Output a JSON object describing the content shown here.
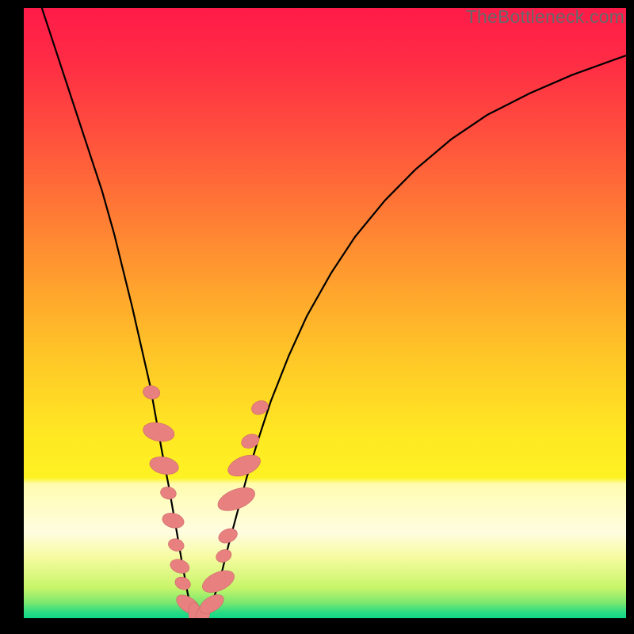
{
  "watermark": "TheBottleneck.com",
  "colors": {
    "gradient_stops": [
      {
        "offset": 0.0,
        "color": "#ff1b49"
      },
      {
        "offset": 0.08,
        "color": "#ff2a45"
      },
      {
        "offset": 0.2,
        "color": "#ff4d3e"
      },
      {
        "offset": 0.32,
        "color": "#ff7536"
      },
      {
        "offset": 0.45,
        "color": "#ffa02e"
      },
      {
        "offset": 0.58,
        "color": "#ffc927"
      },
      {
        "offset": 0.7,
        "color": "#ffe823"
      },
      {
        "offset": 0.77,
        "color": "#fdf223"
      },
      {
        "offset": 0.78,
        "color": "#fffcb0"
      },
      {
        "offset": 0.86,
        "color": "#fffde0"
      },
      {
        "offset": 0.9,
        "color": "#f6fba0"
      },
      {
        "offset": 0.95,
        "color": "#c7f56a"
      },
      {
        "offset": 0.975,
        "color": "#7be86f"
      },
      {
        "offset": 0.99,
        "color": "#2bdc83"
      },
      {
        "offset": 1.0,
        "color": "#0fd789"
      }
    ],
    "curve": "#000000",
    "marker_fill": "#e98080",
    "marker_stroke": "#c96a6a"
  },
  "chart_data": {
    "type": "line",
    "title": "",
    "xlabel": "",
    "ylabel": "",
    "xlim": [
      0,
      100
    ],
    "ylim": [
      0,
      100
    ],
    "series": [
      {
        "name": "bottleneck-curve",
        "x": [
          3,
          5,
          7,
          9,
          11,
          13,
          15,
          16.5,
          18,
          19.5,
          21,
          22,
          23,
          24,
          24.8,
          25.6,
          26.2,
          26.8,
          27.2,
          27.6,
          28,
          28.5,
          29,
          29.8,
          30.5,
          31.3,
          32,
          33,
          34,
          35.5,
          37,
          39,
          41,
          44,
          47,
          51,
          55,
          60,
          65,
          71,
          77,
          84,
          91,
          98,
          100
        ],
        "y": [
          100,
          94,
          88,
          82,
          76,
          70,
          63,
          57,
          51,
          44.5,
          38,
          32.5,
          27,
          22,
          17.5,
          13,
          9.5,
          6.3,
          4.1,
          2.4,
          1.2,
          0.45,
          0.15,
          0.4,
          1.2,
          2.7,
          4.6,
          8,
          12,
          17.5,
          23,
          29.5,
          35.5,
          43,
          49.5,
          56.5,
          62.5,
          68.5,
          73.5,
          78.5,
          82.5,
          86,
          89,
          91.5,
          92.2
        ]
      }
    ],
    "markers": [
      {
        "x": 21.2,
        "y": 37,
        "rx": 1.1,
        "ry": 1.4,
        "rot": -78
      },
      {
        "x": 22.4,
        "y": 30.5,
        "rx": 1.5,
        "ry": 2.6,
        "rot": -78
      },
      {
        "x": 23.3,
        "y": 25,
        "rx": 1.4,
        "ry": 2.4,
        "rot": -78
      },
      {
        "x": 24.0,
        "y": 20.5,
        "rx": 1.0,
        "ry": 1.3,
        "rot": -78
      },
      {
        "x": 24.8,
        "y": 16,
        "rx": 1.2,
        "ry": 1.8,
        "rot": -76
      },
      {
        "x": 25.3,
        "y": 12,
        "rx": 1.0,
        "ry": 1.3,
        "rot": -74
      },
      {
        "x": 25.9,
        "y": 8.5,
        "rx": 1.1,
        "ry": 1.6,
        "rot": -72
      },
      {
        "x": 26.4,
        "y": 5.7,
        "rx": 1.0,
        "ry": 1.3,
        "rot": -68
      },
      {
        "x": 27.3,
        "y": 2.2,
        "rx": 1.2,
        "ry": 2.2,
        "rot": -55
      },
      {
        "x": 28.5,
        "y": 0.4,
        "rx": 1.1,
        "ry": 2.2,
        "rot": -10
      },
      {
        "x": 29.7,
        "y": 0.35,
        "rx": 1.1,
        "ry": 2.0,
        "rot": 15
      },
      {
        "x": 31.2,
        "y": 2.3,
        "rx": 1.2,
        "ry": 2.2,
        "rot": 58
      },
      {
        "x": 32.3,
        "y": 6.0,
        "rx": 1.5,
        "ry": 2.8,
        "rot": 65
      },
      {
        "x": 33.2,
        "y": 10.2,
        "rx": 1.0,
        "ry": 1.3,
        "rot": 66
      },
      {
        "x": 33.9,
        "y": 13.5,
        "rx": 1.1,
        "ry": 1.6,
        "rot": 67
      },
      {
        "x": 35.3,
        "y": 19.5,
        "rx": 1.6,
        "ry": 3.2,
        "rot": 68
      },
      {
        "x": 36.6,
        "y": 25,
        "rx": 1.5,
        "ry": 2.8,
        "rot": 68
      },
      {
        "x": 37.6,
        "y": 29,
        "rx": 1.1,
        "ry": 1.5,
        "rot": 68
      },
      {
        "x": 39.2,
        "y": 34.5,
        "rx": 1.1,
        "ry": 1.4,
        "rot": 66
      }
    ]
  }
}
